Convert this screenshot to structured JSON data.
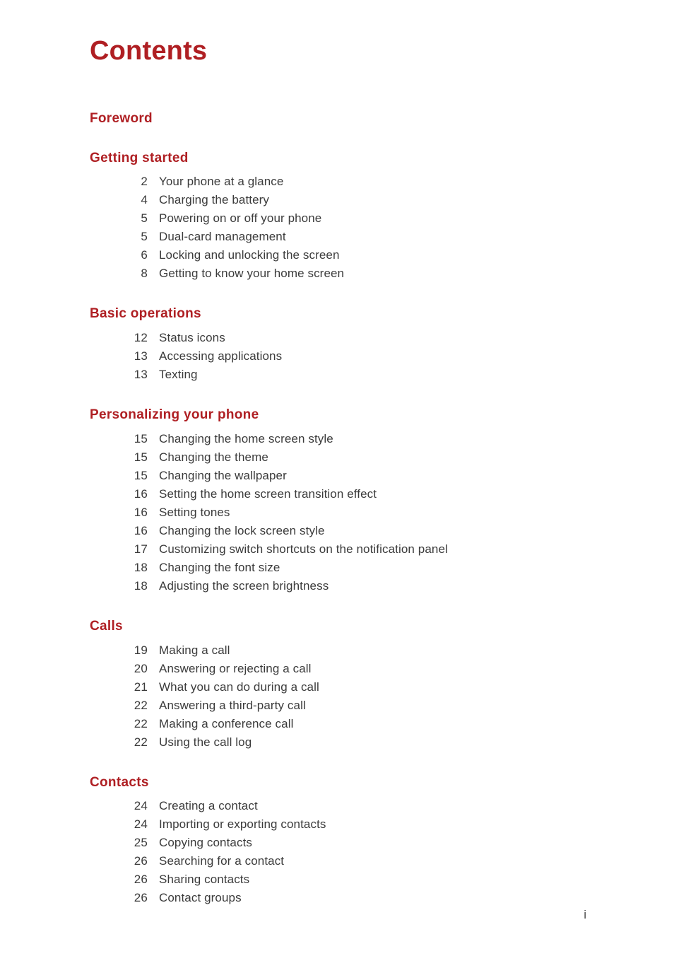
{
  "page": {
    "title": "Contents",
    "folio": "i"
  },
  "sections": [
    {
      "heading": "Foreword",
      "entries": []
    },
    {
      "heading": "Getting started",
      "entries": [
        {
          "page": "2",
          "title": "Your phone at a glance"
        },
        {
          "page": "4",
          "title": "Charging the battery"
        },
        {
          "page": "5",
          "title": "Powering on or off your phone"
        },
        {
          "page": "5",
          "title": "Dual-card management"
        },
        {
          "page": "6",
          "title": "Locking and unlocking the screen"
        },
        {
          "page": "8",
          "title": "Getting to know your home screen"
        }
      ]
    },
    {
      "heading": "Basic operations",
      "entries": [
        {
          "page": "12",
          "title": "Status icons"
        },
        {
          "page": "13",
          "title": "Accessing applications"
        },
        {
          "page": "13",
          "title": "Texting"
        }
      ]
    },
    {
      "heading": "Personalizing your phone",
      "entries": [
        {
          "page": "15",
          "title": "Changing the home screen style"
        },
        {
          "page": "15",
          "title": "Changing the theme"
        },
        {
          "page": "15",
          "title": "Changing the wallpaper"
        },
        {
          "page": "16",
          "title": "Setting the home screen transition effect"
        },
        {
          "page": "16",
          "title": "Setting tones"
        },
        {
          "page": "16",
          "title": "Changing the lock screen style"
        },
        {
          "page": "17",
          "title": "Customizing switch shortcuts on the notification panel"
        },
        {
          "page": "18",
          "title": "Changing the font size"
        },
        {
          "page": "18",
          "title": "Adjusting the screen brightness"
        }
      ]
    },
    {
      "heading": "Calls",
      "entries": [
        {
          "page": "19",
          "title": "Making a call"
        },
        {
          "page": "20",
          "title": "Answering or rejecting a call"
        },
        {
          "page": "21",
          "title": "What you can do during a call"
        },
        {
          "page": "22",
          "title": "Answering a third-party call"
        },
        {
          "page": "22",
          "title": "Making a conference call"
        },
        {
          "page": "22",
          "title": "Using the call log"
        }
      ]
    },
    {
      "heading": "Contacts",
      "entries": [
        {
          "page": "24",
          "title": "Creating a contact"
        },
        {
          "page": "24",
          "title": "Importing or exporting contacts"
        },
        {
          "page": "25",
          "title": "Copying contacts"
        },
        {
          "page": "26",
          "title": "Searching for a contact"
        },
        {
          "page": "26",
          "title": "Sharing contacts"
        },
        {
          "page": "26",
          "title": "Contact groups"
        }
      ]
    }
  ],
  "colors": {
    "heading_red": "#af1f23",
    "body_gray": "#3b3b3b",
    "page_background": "#ffffff"
  }
}
